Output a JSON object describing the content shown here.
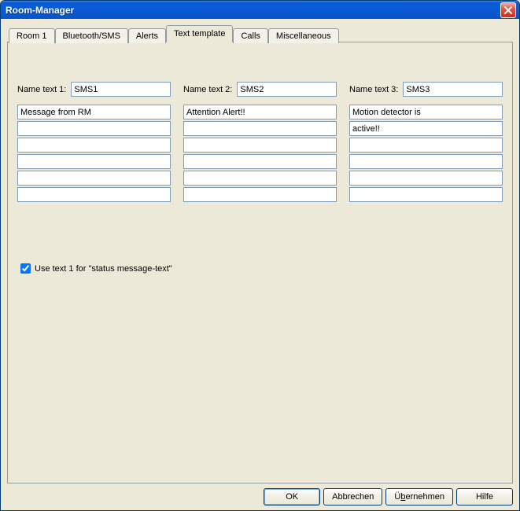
{
  "window": {
    "title": "Room-Manager"
  },
  "tabs": [
    {
      "label": "Room 1"
    },
    {
      "label": "Bluetooth/SMS"
    },
    {
      "label": "Alerts"
    },
    {
      "label": "Text template"
    },
    {
      "label": "Calls"
    },
    {
      "label": "Miscellaneous"
    }
  ],
  "columns": [
    {
      "label": "Name text 1:",
      "name": "SMS1",
      "lines": [
        "Message from RM",
        "",
        "",
        "",
        "",
        ""
      ]
    },
    {
      "label": "Name text 2:",
      "name": "SMS2",
      "lines": [
        "Attention Alert!!",
        "",
        "",
        "",
        "",
        ""
      ]
    },
    {
      "label": "Name text 3:",
      "name": "SMS3",
      "lines": [
        "Motion detector is",
        "active!!",
        "",
        "",
        "",
        ""
      ]
    }
  ],
  "checkbox": {
    "checked": true,
    "label": "Use text 1 for \"status message-text\""
  },
  "buttons": {
    "ok": "OK",
    "cancel": "Abbrechen",
    "apply_pre": "Ü",
    "apply_u": "b",
    "apply_post": "ernehmen",
    "help": "Hilfe"
  }
}
